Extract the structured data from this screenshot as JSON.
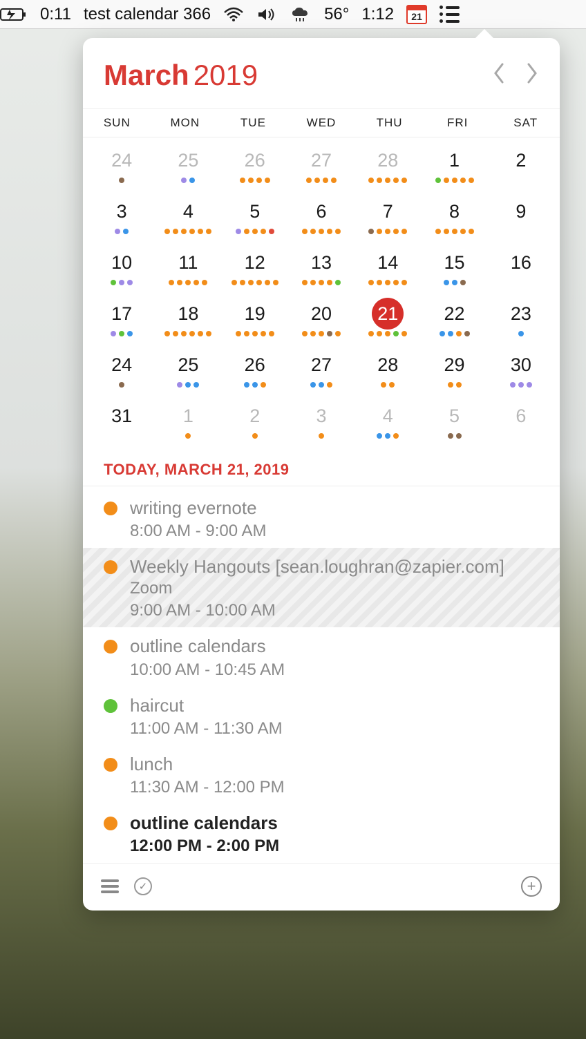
{
  "menubar": {
    "timer": "0:11",
    "title": "test calendar 366",
    "temp": "56°",
    "clock": "1:12",
    "cal_badge": "21"
  },
  "header": {
    "month": "March",
    "year": "2019"
  },
  "weekdays": [
    "SUN",
    "MON",
    "TUE",
    "WED",
    "THU",
    "FRI",
    "SAT"
  ],
  "rows": [
    [
      {
        "n": "24",
        "other": true,
        "dots": [
          "br"
        ]
      },
      {
        "n": "25",
        "other": true,
        "dots": [
          "p",
          "b"
        ]
      },
      {
        "n": "26",
        "other": true,
        "dots": [
          "o",
          "o",
          "o",
          "o"
        ]
      },
      {
        "n": "27",
        "other": true,
        "dots": [
          "o",
          "o",
          "o",
          "o"
        ]
      },
      {
        "n": "28",
        "other": true,
        "dots": [
          "o",
          "o",
          "o",
          "o",
          "o"
        ]
      },
      {
        "n": "1",
        "dots": [
          "g",
          "o",
          "o",
          "o",
          "o"
        ]
      },
      {
        "n": "2",
        "dots": []
      }
    ],
    [
      {
        "n": "3",
        "dots": [
          "p",
          "b"
        ]
      },
      {
        "n": "4",
        "dots": [
          "o",
          "o",
          "o",
          "o",
          "o",
          "o"
        ]
      },
      {
        "n": "5",
        "dots": [
          "p",
          "o",
          "o",
          "o",
          "r"
        ]
      },
      {
        "n": "6",
        "dots": [
          "o",
          "o",
          "o",
          "o",
          "o"
        ]
      },
      {
        "n": "7",
        "dots": [
          "br",
          "o",
          "o",
          "o",
          "o"
        ]
      },
      {
        "n": "8",
        "dots": [
          "o",
          "o",
          "o",
          "o",
          "o"
        ]
      },
      {
        "n": "9",
        "dots": []
      }
    ],
    [
      {
        "n": "10",
        "dots": [
          "g",
          "p",
          "p"
        ]
      },
      {
        "n": "11",
        "dots": [
          "o",
          "o",
          "o",
          "o",
          "o"
        ]
      },
      {
        "n": "12",
        "dots": [
          "o",
          "o",
          "o",
          "o",
          "o",
          "o"
        ]
      },
      {
        "n": "13",
        "dots": [
          "o",
          "o",
          "o",
          "o",
          "g"
        ]
      },
      {
        "n": "14",
        "dots": [
          "o",
          "o",
          "o",
          "o",
          "o"
        ]
      },
      {
        "n": "15",
        "dots": [
          "b",
          "b",
          "br"
        ]
      },
      {
        "n": "16",
        "dots": []
      }
    ],
    [
      {
        "n": "17",
        "dots": [
          "p",
          "g",
          "b"
        ]
      },
      {
        "n": "18",
        "dots": [
          "o",
          "o",
          "o",
          "o",
          "o",
          "o"
        ]
      },
      {
        "n": "19",
        "dots": [
          "o",
          "o",
          "o",
          "o",
          "o"
        ]
      },
      {
        "n": "20",
        "dots": [
          "o",
          "o",
          "o",
          "br",
          "o"
        ]
      },
      {
        "n": "21",
        "today": true,
        "dots": [
          "o",
          "o",
          "o",
          "g",
          "o"
        ]
      },
      {
        "n": "22",
        "dots": [
          "b",
          "b",
          "o",
          "br"
        ]
      },
      {
        "n": "23",
        "dots": [
          "b"
        ]
      }
    ],
    [
      {
        "n": "24",
        "dots": [
          "br"
        ]
      },
      {
        "n": "25",
        "dots": [
          "p",
          "b",
          "b"
        ]
      },
      {
        "n": "26",
        "dots": [
          "b",
          "b",
          "o"
        ]
      },
      {
        "n": "27",
        "dots": [
          "b",
          "b",
          "o"
        ]
      },
      {
        "n": "28",
        "dots": [
          "o",
          "o"
        ]
      },
      {
        "n": "29",
        "dots": [
          "o",
          "o"
        ]
      },
      {
        "n": "30",
        "dots": [
          "p",
          "p",
          "p"
        ]
      }
    ],
    [
      {
        "n": "31",
        "dots": []
      },
      {
        "n": "1",
        "other": true,
        "dots": [
          "o"
        ]
      },
      {
        "n": "2",
        "other": true,
        "dots": [
          "o"
        ]
      },
      {
        "n": "3",
        "other": true,
        "dots": [
          "o"
        ]
      },
      {
        "n": "4",
        "other": true,
        "dots": [
          "b",
          "b",
          "o"
        ]
      },
      {
        "n": "5",
        "other": true,
        "dots": [
          "br",
          "br"
        ]
      },
      {
        "n": "6",
        "other": true,
        "dots": []
      }
    ]
  ],
  "today_heading": "TODAY, MARCH 21, 2019",
  "events": [
    {
      "color": "o",
      "title": "writing evernote",
      "time": "8:00 AM - 9:00 AM",
      "past": true
    },
    {
      "color": "o",
      "title": "Weekly Hangouts [sean.loughran@zapier.com]",
      "loc": "Zoom",
      "time": "9:00 AM - 10:00 AM",
      "past": true,
      "striped": true
    },
    {
      "color": "o",
      "title": "outline calendars",
      "time": "10:00 AM - 10:45 AM",
      "past": true
    },
    {
      "color": "g",
      "title": "haircut",
      "time": "11:00 AM - 11:30 AM",
      "past": true
    },
    {
      "color": "o",
      "title": "lunch",
      "time": "11:30 AM - 12:00 PM",
      "past": true
    },
    {
      "color": "o",
      "title": "outline calendars",
      "time": "12:00 PM - 2:00 PM",
      "past": false
    }
  ]
}
